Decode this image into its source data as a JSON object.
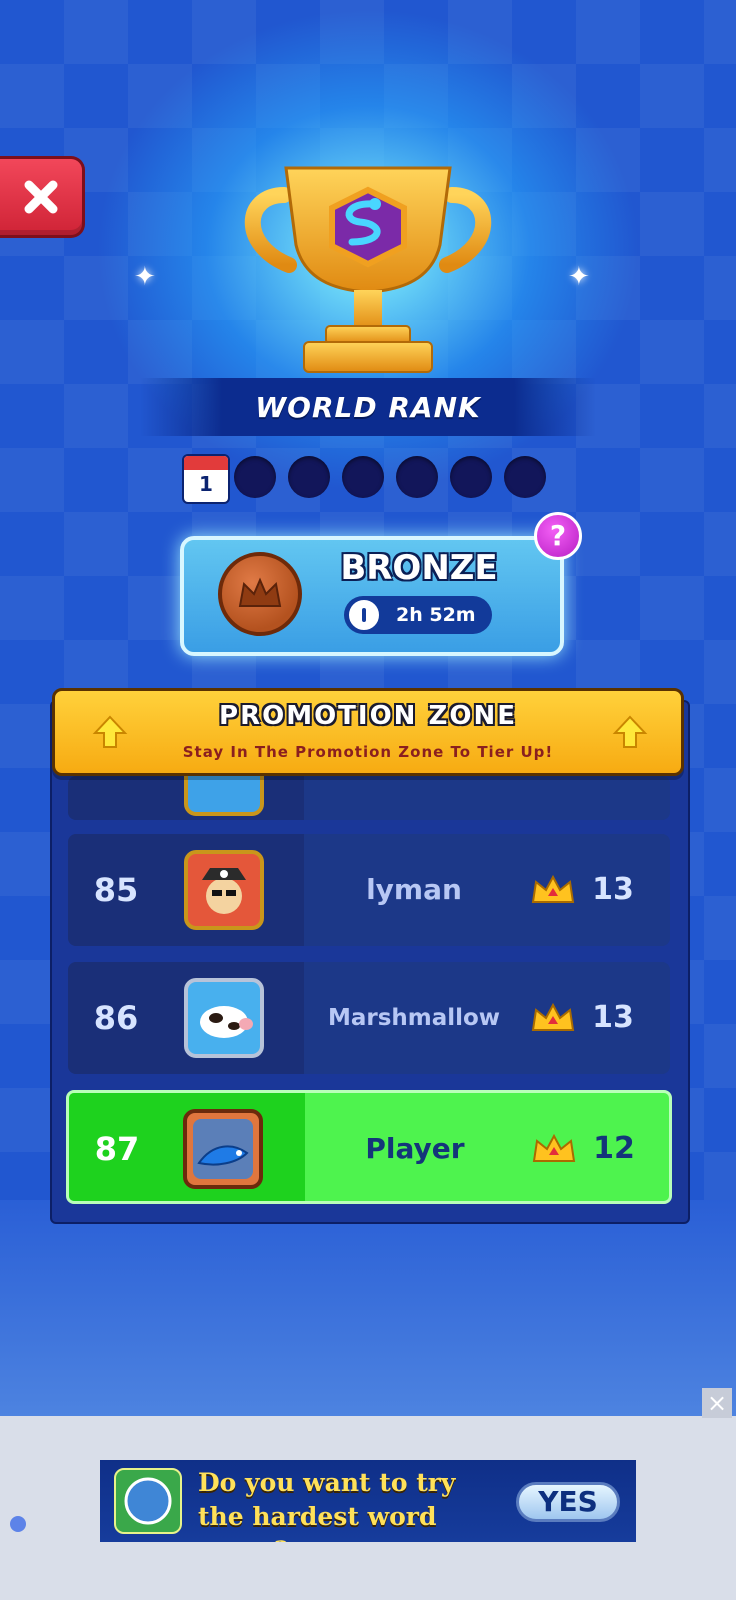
{
  "header": {
    "title": "WORLD RANK",
    "calendar_day": "1"
  },
  "tier": {
    "name": "BRONZE",
    "time_left": "2h 52m",
    "help_label": "?"
  },
  "promotion": {
    "title": "PROMOTION ZONE",
    "subtitle": "Stay In The Promotion Zone To Tier Up!"
  },
  "leaderboard": {
    "rows": [
      {
        "rank": "85",
        "name": "lyman",
        "score": "13",
        "avatar": "pirate-cat-avatar"
      },
      {
        "rank": "86",
        "name": "Marshmallow",
        "score": "13",
        "avatar": "cow-avatar"
      },
      {
        "rank": "87",
        "name": "Player",
        "score": "12",
        "avatar": "blue-snake-avatar",
        "highlight": true
      }
    ]
  },
  "ad": {
    "line1": "Do you want to try",
    "line2": "the hardest word game?",
    "cta": "YES",
    "close_label": "×"
  },
  "colors": {
    "background": "#2157d0",
    "promo_yellow": "#ffd13b",
    "player_green": "#4ef34e",
    "close_red": "#e43145",
    "bronze": "#c4642f"
  }
}
